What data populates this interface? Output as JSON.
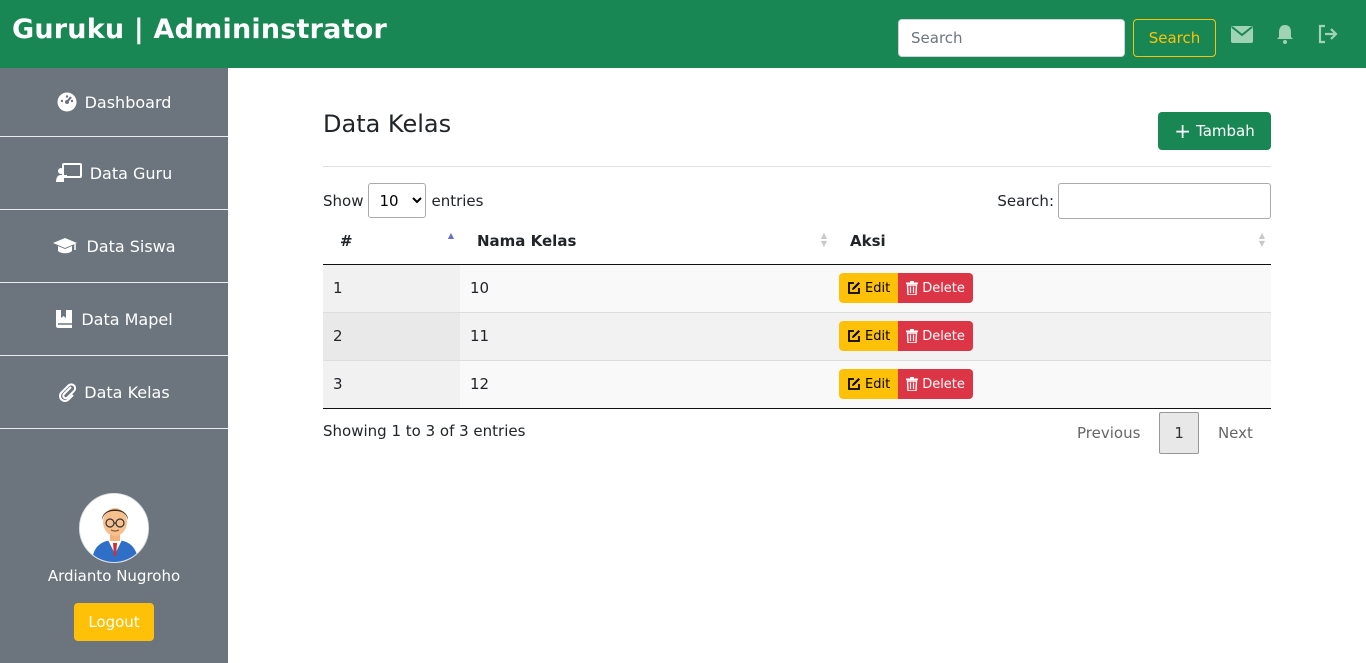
{
  "header": {
    "brand": "Guruku | Admininstrator",
    "search_placeholder": "Search",
    "search_button": "Search",
    "icons": [
      "envelope-icon",
      "bell-icon",
      "sign-out-icon"
    ]
  },
  "sidebar": {
    "items": [
      {
        "label": "Dashboard",
        "icon": "dashboard-gauge-icon"
      },
      {
        "label": "Data Guru",
        "icon": "teacher-board-icon"
      },
      {
        "label": "Data Siswa",
        "icon": "graduation-cap-icon"
      },
      {
        "label": "Data Mapel",
        "icon": "book-icon"
      },
      {
        "label": "Data Kelas",
        "icon": "paperclip-icon"
      }
    ],
    "user_name": "Ardianto Nugroho",
    "logout_label": "Logout"
  },
  "main": {
    "title": "Data Kelas",
    "add_button": "Tambah",
    "length": {
      "show": "Show",
      "value": "10",
      "entries": "entries"
    },
    "filter_label": "Search:",
    "columns": [
      "#",
      "Nama Kelas",
      "Aksi"
    ],
    "rows": [
      {
        "no": "1",
        "nama": "10"
      },
      {
        "no": "2",
        "nama": "11"
      },
      {
        "no": "3",
        "nama": "12"
      }
    ],
    "edit_label": "Edit",
    "delete_label": "Delete",
    "info": "Showing 1 to 3 of 3 entries",
    "pagination": {
      "previous": "Previous",
      "current": "1",
      "next": "Next"
    }
  },
  "colors": {
    "brand_green": "#198754",
    "sidebar_gray": "#6c757d",
    "warning_yellow": "#ffc107",
    "danger_red": "#dc3545"
  }
}
